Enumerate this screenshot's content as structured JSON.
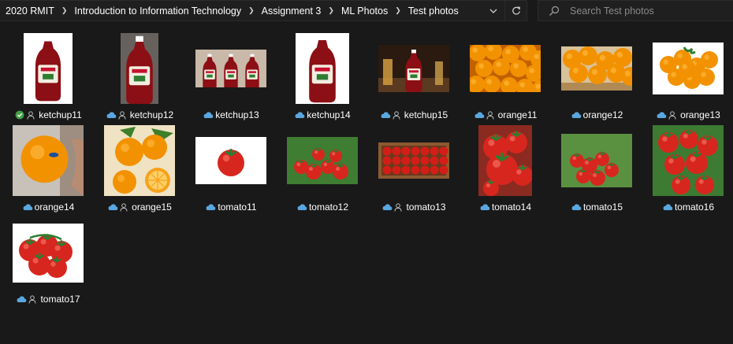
{
  "breadcrumb": [
    "2020 RMIT",
    "Introduction to Information Technology",
    "Assignment 3",
    "ML Photos",
    "Test photos"
  ],
  "search": {
    "placeholder": "Search Test photos"
  },
  "icons": {
    "breadcrumb_separator": "chevron-right-icon",
    "history": "chevron-down-icon",
    "refresh": "refresh-icon",
    "search": "search-icon",
    "cloud": "cloud-icon",
    "synced": "check-circle-icon",
    "shared": "person-icon"
  },
  "colors": {
    "background": "#191919",
    "text": "#ffffff",
    "cloud": "#5aa7e0",
    "synced": "#43a047",
    "person": "#bdbdbd"
  },
  "files": [
    {
      "name": "ketchup11",
      "status": "synced",
      "shared": true,
      "subject": "ketchup bottle"
    },
    {
      "name": "ketchup12",
      "status": "cloud",
      "shared": true,
      "subject": "ketchup bottle"
    },
    {
      "name": "ketchup13",
      "status": "cloud",
      "shared": false,
      "subject": "ketchup bottles"
    },
    {
      "name": "ketchup14",
      "status": "cloud",
      "shared": false,
      "subject": "ketchup bottle"
    },
    {
      "name": "ketchup15",
      "status": "cloud",
      "shared": true,
      "subject": "ketchup bottles"
    },
    {
      "name": "orange11",
      "status": "cloud",
      "shared": true,
      "subject": "oranges"
    },
    {
      "name": "orange12",
      "status": "cloud",
      "shared": false,
      "subject": "oranges"
    },
    {
      "name": "orange13",
      "status": "cloud",
      "shared": true,
      "subject": "oranges"
    },
    {
      "name": "orange14",
      "status": "cloud",
      "shared": false,
      "subject": "orange in hand"
    },
    {
      "name": "orange15",
      "status": "cloud",
      "shared": true,
      "subject": "oranges"
    },
    {
      "name": "tomato11",
      "status": "cloud",
      "shared": false,
      "subject": "tomato"
    },
    {
      "name": "tomato12",
      "status": "cloud",
      "shared": false,
      "subject": "tomatoes on vine"
    },
    {
      "name": "tomato13",
      "status": "cloud",
      "shared": true,
      "subject": "tomatoes in crate"
    },
    {
      "name": "tomato14",
      "status": "cloud",
      "shared": false,
      "subject": "tomatoes"
    },
    {
      "name": "tomato15",
      "status": "cloud",
      "shared": false,
      "subject": "tomatoes on vine"
    },
    {
      "name": "tomato16",
      "status": "cloud",
      "shared": false,
      "subject": "tomatoes on vine"
    },
    {
      "name": "tomato17",
      "status": "cloud",
      "shared": true,
      "subject": "tomatoes"
    }
  ]
}
